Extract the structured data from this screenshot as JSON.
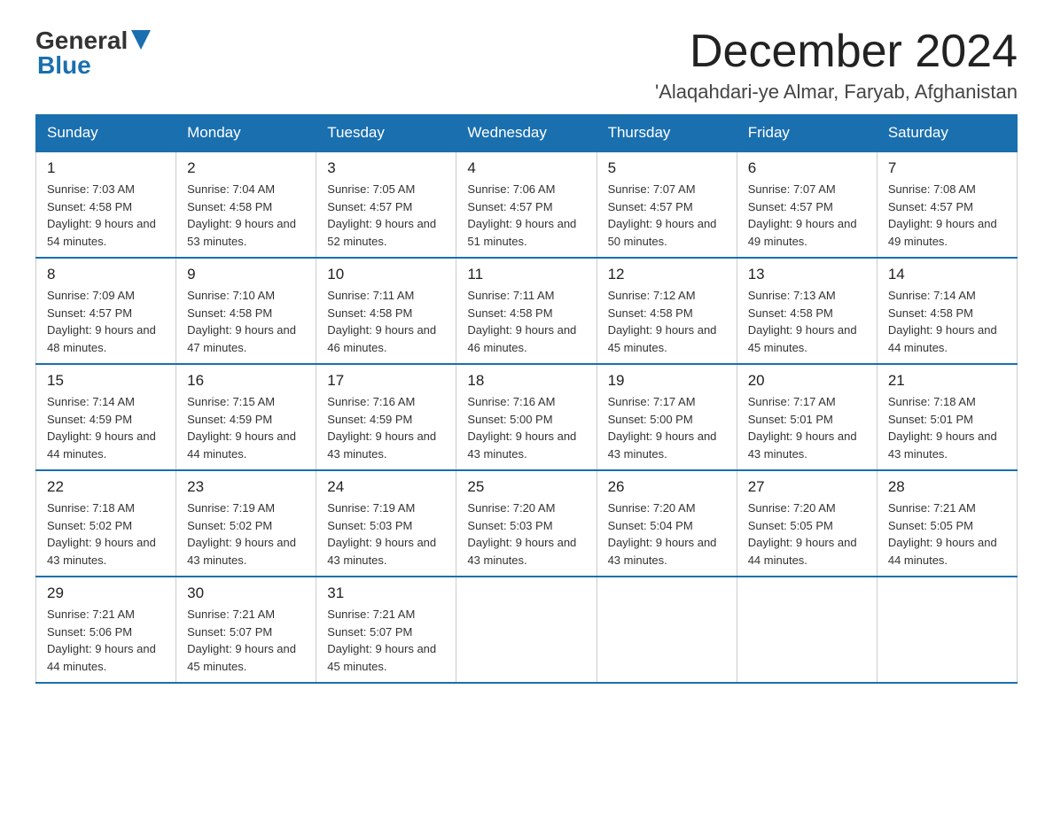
{
  "header": {
    "logo_general": "General",
    "logo_blue": "Blue",
    "month_title": "December 2024",
    "subtitle": "'Alaqahdari-ye Almar, Faryab, Afghanistan"
  },
  "weekdays": [
    "Sunday",
    "Monday",
    "Tuesday",
    "Wednesday",
    "Thursday",
    "Friday",
    "Saturday"
  ],
  "weeks": [
    [
      {
        "day": "1",
        "sunrise": "Sunrise: 7:03 AM",
        "sunset": "Sunset: 4:58 PM",
        "daylight": "Daylight: 9 hours and 54 minutes."
      },
      {
        "day": "2",
        "sunrise": "Sunrise: 7:04 AM",
        "sunset": "Sunset: 4:58 PM",
        "daylight": "Daylight: 9 hours and 53 minutes."
      },
      {
        "day": "3",
        "sunrise": "Sunrise: 7:05 AM",
        "sunset": "Sunset: 4:57 PM",
        "daylight": "Daylight: 9 hours and 52 minutes."
      },
      {
        "day": "4",
        "sunrise": "Sunrise: 7:06 AM",
        "sunset": "Sunset: 4:57 PM",
        "daylight": "Daylight: 9 hours and 51 minutes."
      },
      {
        "day": "5",
        "sunrise": "Sunrise: 7:07 AM",
        "sunset": "Sunset: 4:57 PM",
        "daylight": "Daylight: 9 hours and 50 minutes."
      },
      {
        "day": "6",
        "sunrise": "Sunrise: 7:07 AM",
        "sunset": "Sunset: 4:57 PM",
        "daylight": "Daylight: 9 hours and 49 minutes."
      },
      {
        "day": "7",
        "sunrise": "Sunrise: 7:08 AM",
        "sunset": "Sunset: 4:57 PM",
        "daylight": "Daylight: 9 hours and 49 minutes."
      }
    ],
    [
      {
        "day": "8",
        "sunrise": "Sunrise: 7:09 AM",
        "sunset": "Sunset: 4:57 PM",
        "daylight": "Daylight: 9 hours and 48 minutes."
      },
      {
        "day": "9",
        "sunrise": "Sunrise: 7:10 AM",
        "sunset": "Sunset: 4:58 PM",
        "daylight": "Daylight: 9 hours and 47 minutes."
      },
      {
        "day": "10",
        "sunrise": "Sunrise: 7:11 AM",
        "sunset": "Sunset: 4:58 PM",
        "daylight": "Daylight: 9 hours and 46 minutes."
      },
      {
        "day": "11",
        "sunrise": "Sunrise: 7:11 AM",
        "sunset": "Sunset: 4:58 PM",
        "daylight": "Daylight: 9 hours and 46 minutes."
      },
      {
        "day": "12",
        "sunrise": "Sunrise: 7:12 AM",
        "sunset": "Sunset: 4:58 PM",
        "daylight": "Daylight: 9 hours and 45 minutes."
      },
      {
        "day": "13",
        "sunrise": "Sunrise: 7:13 AM",
        "sunset": "Sunset: 4:58 PM",
        "daylight": "Daylight: 9 hours and 45 minutes."
      },
      {
        "day": "14",
        "sunrise": "Sunrise: 7:14 AM",
        "sunset": "Sunset: 4:58 PM",
        "daylight": "Daylight: 9 hours and 44 minutes."
      }
    ],
    [
      {
        "day": "15",
        "sunrise": "Sunrise: 7:14 AM",
        "sunset": "Sunset: 4:59 PM",
        "daylight": "Daylight: 9 hours and 44 minutes."
      },
      {
        "day": "16",
        "sunrise": "Sunrise: 7:15 AM",
        "sunset": "Sunset: 4:59 PM",
        "daylight": "Daylight: 9 hours and 44 minutes."
      },
      {
        "day": "17",
        "sunrise": "Sunrise: 7:16 AM",
        "sunset": "Sunset: 4:59 PM",
        "daylight": "Daylight: 9 hours and 43 minutes."
      },
      {
        "day": "18",
        "sunrise": "Sunrise: 7:16 AM",
        "sunset": "Sunset: 5:00 PM",
        "daylight": "Daylight: 9 hours and 43 minutes."
      },
      {
        "day": "19",
        "sunrise": "Sunrise: 7:17 AM",
        "sunset": "Sunset: 5:00 PM",
        "daylight": "Daylight: 9 hours and 43 minutes."
      },
      {
        "day": "20",
        "sunrise": "Sunrise: 7:17 AM",
        "sunset": "Sunset: 5:01 PM",
        "daylight": "Daylight: 9 hours and 43 minutes."
      },
      {
        "day": "21",
        "sunrise": "Sunrise: 7:18 AM",
        "sunset": "Sunset: 5:01 PM",
        "daylight": "Daylight: 9 hours and 43 minutes."
      }
    ],
    [
      {
        "day": "22",
        "sunrise": "Sunrise: 7:18 AM",
        "sunset": "Sunset: 5:02 PM",
        "daylight": "Daylight: 9 hours and 43 minutes."
      },
      {
        "day": "23",
        "sunrise": "Sunrise: 7:19 AM",
        "sunset": "Sunset: 5:02 PM",
        "daylight": "Daylight: 9 hours and 43 minutes."
      },
      {
        "day": "24",
        "sunrise": "Sunrise: 7:19 AM",
        "sunset": "Sunset: 5:03 PM",
        "daylight": "Daylight: 9 hours and 43 minutes."
      },
      {
        "day": "25",
        "sunrise": "Sunrise: 7:20 AM",
        "sunset": "Sunset: 5:03 PM",
        "daylight": "Daylight: 9 hours and 43 minutes."
      },
      {
        "day": "26",
        "sunrise": "Sunrise: 7:20 AM",
        "sunset": "Sunset: 5:04 PM",
        "daylight": "Daylight: 9 hours and 43 minutes."
      },
      {
        "day": "27",
        "sunrise": "Sunrise: 7:20 AM",
        "sunset": "Sunset: 5:05 PM",
        "daylight": "Daylight: 9 hours and 44 minutes."
      },
      {
        "day": "28",
        "sunrise": "Sunrise: 7:21 AM",
        "sunset": "Sunset: 5:05 PM",
        "daylight": "Daylight: 9 hours and 44 minutes."
      }
    ],
    [
      {
        "day": "29",
        "sunrise": "Sunrise: 7:21 AM",
        "sunset": "Sunset: 5:06 PM",
        "daylight": "Daylight: 9 hours and 44 minutes."
      },
      {
        "day": "30",
        "sunrise": "Sunrise: 7:21 AM",
        "sunset": "Sunset: 5:07 PM",
        "daylight": "Daylight: 9 hours and 45 minutes."
      },
      {
        "day": "31",
        "sunrise": "Sunrise: 7:21 AM",
        "sunset": "Sunset: 5:07 PM",
        "daylight": "Daylight: 9 hours and 45 minutes."
      },
      null,
      null,
      null,
      null
    ]
  ]
}
